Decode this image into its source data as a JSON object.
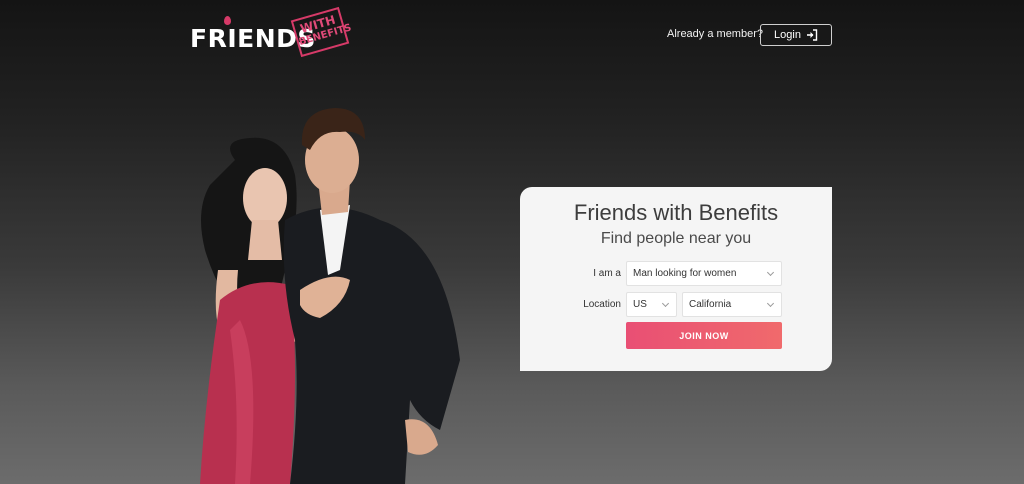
{
  "header": {
    "logo": {
      "main": "FRIENDS",
      "stamp_top": "WITH",
      "stamp_bottom": "BENEFITS"
    },
    "member_text": "Already a member?",
    "login_label": "Login"
  },
  "card": {
    "title": "Friends with Benefits",
    "subtitle": "Find people near you",
    "i_am_label": "I am a",
    "i_am_value": "Man looking for women",
    "location_label": "Location",
    "country_value": "US",
    "state_value": "California",
    "join_label": "JOIN NOW"
  },
  "colors": {
    "brand_pink": "#d63a68",
    "join_start": "#e94f74",
    "join_end": "#f06a6c"
  }
}
